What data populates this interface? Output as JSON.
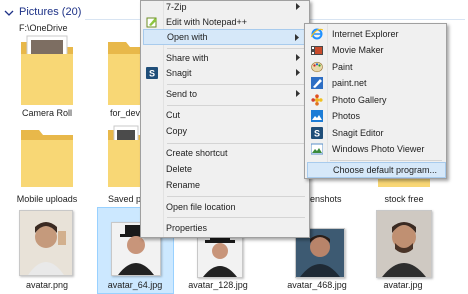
{
  "header": {
    "title": "Pictures (20)",
    "path": "F:\\OneDrive"
  },
  "items": [
    {
      "label": "Camera Roll"
    },
    {
      "label": "for_dev"
    },
    {
      "label": "Mobile uploads"
    },
    {
      "label": "Saved p"
    },
    {
      "label": "enshots"
    },
    {
      "label": "stock free"
    },
    {
      "label": "avatar.png"
    },
    {
      "label": "avatar_64.jpg"
    },
    {
      "label": "avatar_128.jpg"
    },
    {
      "label": "avatar_468.jpg"
    },
    {
      "label": "avatar.jpg"
    }
  ],
  "context_menu": {
    "items": [
      {
        "label": "7-Zip"
      },
      {
        "label": "Edit with Notepad++"
      },
      {
        "label": "Open with"
      },
      {
        "label": "Share with"
      },
      {
        "label": "Snagit"
      },
      {
        "label": "Send to"
      },
      {
        "label": "Cut"
      },
      {
        "label": "Copy"
      },
      {
        "label": "Create shortcut"
      },
      {
        "label": "Delete"
      },
      {
        "label": "Rename"
      },
      {
        "label": "Open file location"
      },
      {
        "label": "Properties"
      }
    ]
  },
  "open_with_menu": {
    "items": [
      {
        "label": "Internet Explorer"
      },
      {
        "label": "Movie Maker"
      },
      {
        "label": "Paint"
      },
      {
        "label": "paint.net"
      },
      {
        "label": "Photo Gallery"
      },
      {
        "label": "Photos"
      },
      {
        "label": "Snagit Editor"
      },
      {
        "label": "Windows Photo Viewer"
      },
      {
        "label": "Choose default program..."
      }
    ]
  },
  "colors": {
    "accent": "#1e3287",
    "highlight": "#d6e8f9",
    "selection": "#cce8ff",
    "folder": "#f8d775"
  }
}
